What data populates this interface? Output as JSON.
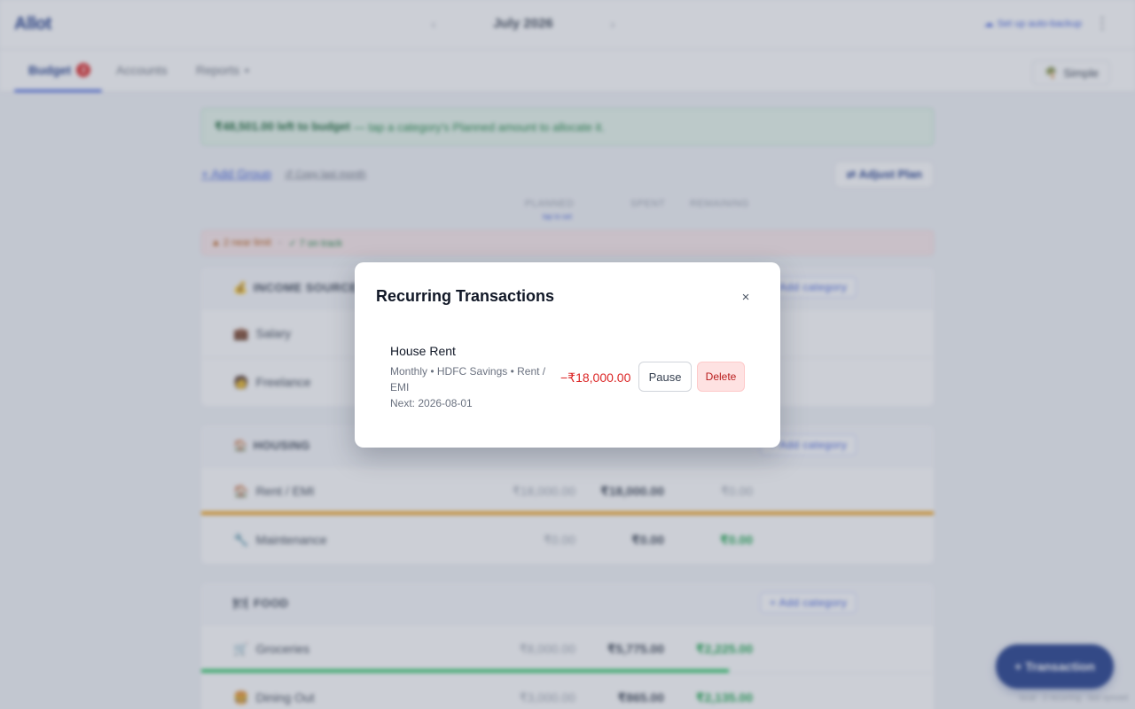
{
  "app": {
    "logo": "Allot",
    "month": "July 2026",
    "backup_label": "Set up auto-backup",
    "tabs": [
      {
        "label": "Budget",
        "badge": "2"
      },
      {
        "label": "Accounts"
      },
      {
        "label": "Reports"
      }
    ],
    "reports_dot": "•",
    "mode_label": "Simple",
    "banner": {
      "amount": "₹48,501.00 left to budget",
      "hint": "— tap a category's Planned amount to allocate it."
    },
    "add_group_label": "+ Add Group",
    "copy_last_label": "↺ Copy last month",
    "adjust_plan_label": "⇄ Adjust Plan",
    "columns": {
      "planned": "PLANNED",
      "tap_hint": "tap to set",
      "spent": "SPENT",
      "remaining": "REMAINING"
    },
    "status": {
      "warn": "2 near limit",
      "ok": "7 on track"
    },
    "add_category_label": "+ Add category",
    "groups": [
      {
        "name": "INCOME SOURCES",
        "rows": [
          {
            "label": "Salary"
          },
          {
            "label": "Freelance"
          }
        ]
      },
      {
        "name": "HOUSING",
        "rows": [
          {
            "label": "Rent / EMI",
            "planned": "₹18,000.00",
            "spent": "₹18,000.00",
            "remaining": "₹0.00"
          },
          {
            "label": "Maintenance",
            "planned": "₹0.00",
            "spent": "₹0.00",
            "remaining": "₹0.00"
          }
        ]
      },
      {
        "name": "FOOD",
        "rows": [
          {
            "label": "Groceries",
            "planned": "₹8,000.00",
            "spent": "₹5,775.00",
            "remaining": "₹2,225.00"
          },
          {
            "label": "Dining Out",
            "planned": "₹3,000.00",
            "spent": "₹865.00",
            "remaining": "₹2,135.00"
          }
        ]
      }
    ],
    "fab_label": "+ Transaction",
    "footer_note": "local · 2 recurring · last synced"
  },
  "modal": {
    "title": "Recurring Transactions",
    "close_glyph": "×",
    "items": [
      {
        "name": "House Rent",
        "meta": "Monthly • HDFC Savings • Rent / EMI",
        "next": "Next: 2026-08-01",
        "amount": "−₹18,000.00",
        "pause_label": "Pause",
        "delete_label": "Delete"
      }
    ]
  },
  "colors": {
    "brand": "#1e3a8a",
    "accent": "#3b5bdb",
    "danger": "#dc2626",
    "success": "#16a34a",
    "warning_bar": "#f59e0b"
  }
}
